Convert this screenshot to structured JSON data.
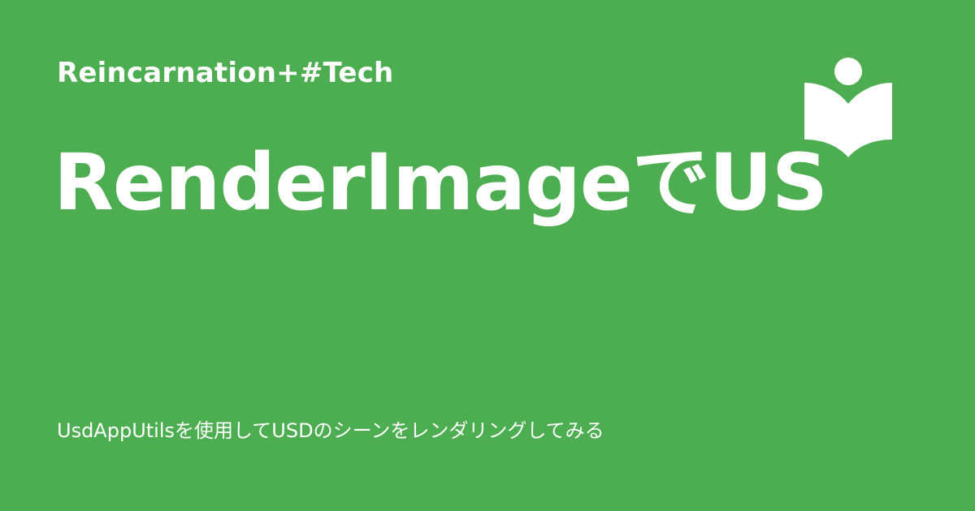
{
  "site": {
    "name": "Reincarnation+#Tech",
    "logo_icon": "reading-person-book-icon"
  },
  "article": {
    "title": "RenderImageでUS",
    "description": "UsdAppUtilsを使用してUSDのシーンをレンダリングしてみる"
  },
  "colors": {
    "background": "#4CAE50",
    "text": "#FFFFFF"
  }
}
